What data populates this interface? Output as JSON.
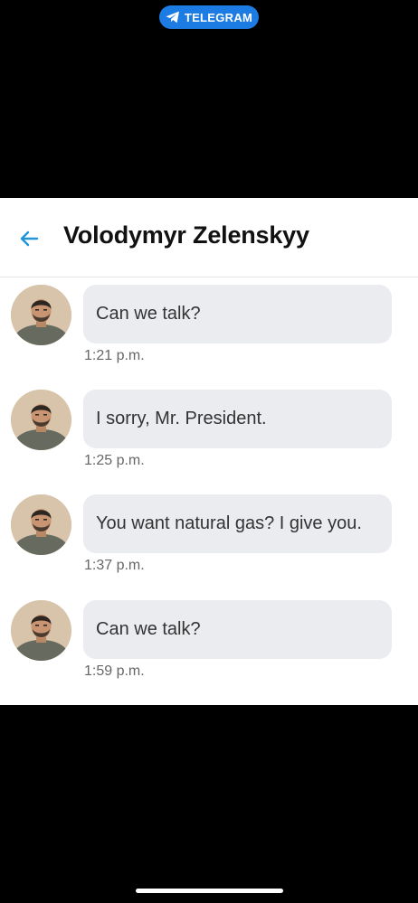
{
  "app_badge": {
    "label": "TELEGRAM",
    "icon": "telegram-plane-icon",
    "color": "#1d7ce3"
  },
  "chat": {
    "contact_name": "Volodymyr Zelenskyy",
    "back_icon": "back-arrow-icon",
    "accent_color": "#2196d6",
    "messages": [
      {
        "text": "Can we talk?",
        "time": "1:21 p.m."
      },
      {
        "text": "I sorry, Mr. President.",
        "time": "1:25 p.m."
      },
      {
        "text": "You want natural gas? I give you.",
        "time": "1:37 p.m."
      },
      {
        "text": "Can we talk?",
        "time": "1:59 p.m."
      }
    ]
  }
}
